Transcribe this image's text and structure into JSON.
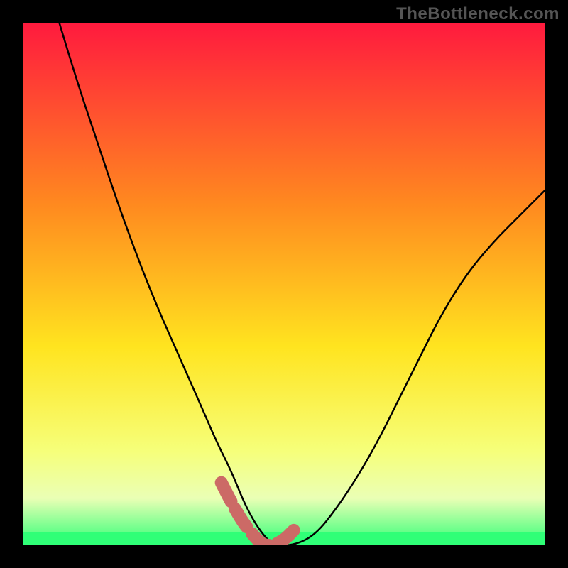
{
  "watermark": "TheBottleneck.com",
  "colors": {
    "background": "#000000",
    "gradient_top": "#ff1a3e",
    "gradient_mid1": "#ff8a1f",
    "gradient_mid2": "#ffe41f",
    "gradient_low": "#f6ff7a",
    "gradient_band": "#eaffb5",
    "gradient_green": "#2fff77",
    "curve": "#000000",
    "highlight": "#cc6a66"
  },
  "chart_data": {
    "type": "line",
    "title": "",
    "xlabel": "",
    "ylabel": "",
    "xlim": [
      0,
      100
    ],
    "ylim": [
      0,
      100
    ],
    "series": [
      {
        "name": "bottleneck-curve",
        "x": [
          7,
          10,
          14,
          18,
          22,
          26,
          30,
          34,
          37,
          40,
          42,
          44,
          46,
          48,
          52,
          56,
          60,
          64,
          68,
          72,
          76,
          80,
          85,
          90,
          95,
          100
        ],
        "y": [
          100,
          90,
          78,
          66,
          55,
          45,
          36,
          27,
          20,
          14,
          9,
          5,
          2,
          0,
          0,
          2,
          7,
          13,
          20,
          28,
          36,
          44,
          52,
          58,
          63,
          68
        ]
      }
    ],
    "highlight_region": {
      "name": "optimal-band",
      "x": [
        38,
        41,
        44,
        46,
        48,
        50,
        52
      ],
      "y": [
        12,
        6,
        2,
        0,
        0,
        1,
        3
      ]
    }
  }
}
